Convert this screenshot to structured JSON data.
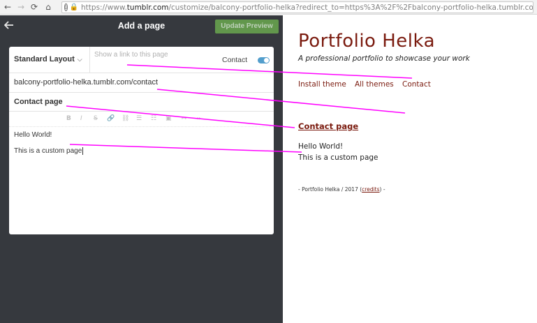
{
  "browser": {
    "url_prefix": "https://www.",
    "url_host": "tumblr.com",
    "url_rest": "/customize/balcony-portfolio-helka?redirect_to=https%3A%2F%2Fbalcony-portfolio-helka.tumblr.com"
  },
  "panel": {
    "title": "Add a page",
    "update_button": "Update Preview"
  },
  "form": {
    "layout_select": "Standard Layout",
    "link_placeholder": "Show a link to this page",
    "link_label": "Contact",
    "link_toggle_on": true,
    "page_url": "balcony-portfolio-helka.tumblr.com/contact",
    "page_title": "Contact page",
    "toolbar": [
      "B",
      "I",
      "S",
      "link",
      "unlink",
      "bullet-list",
      "numbered-list",
      "image",
      "embed",
      "html"
    ],
    "body_lines": [
      "Hello World!",
      "This is a custom page"
    ]
  },
  "preview": {
    "blog_title": "Portfolio Helka",
    "blog_description": "A professional portfolio to showcase your work",
    "nav_links": [
      "Install theme",
      "All themes",
      "Contact"
    ],
    "page_heading": "Contact page",
    "page_body": [
      "Hello World!",
      "This is a custom page"
    ],
    "footer_prefix": "- Portfolio Helka / 2017 (",
    "footer_link": "credits",
    "footer_suffix": ") -"
  },
  "colors": {
    "accent": "#7a1a0e",
    "panel_bg": "#36393e",
    "update_button": "#6aa84f",
    "toggle": "#529ecc",
    "annotation": "#ff00ff"
  }
}
